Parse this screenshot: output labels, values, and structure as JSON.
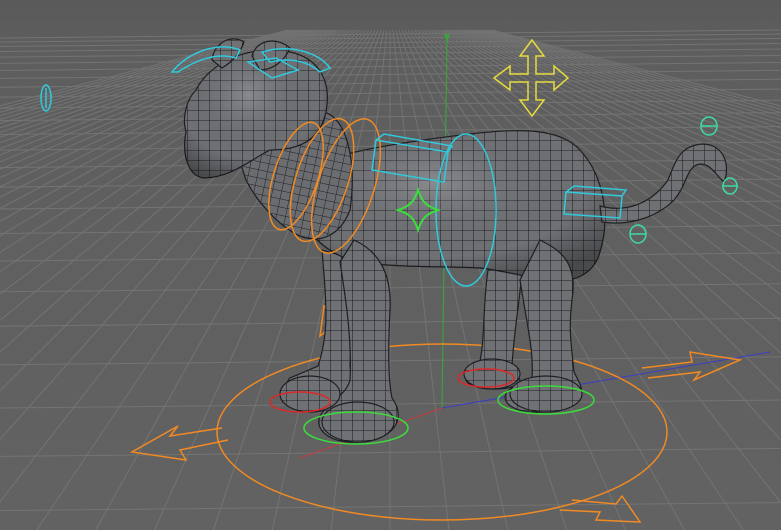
{
  "viewport": {
    "background_color": "#5e5e5e",
    "grid_color": "#767676",
    "mesh_fill_color": "#6e7074",
    "mesh_wire_color": "#1e1f22"
  },
  "subject": {
    "model": "cat-mesh",
    "display": "wireframe-shaded"
  },
  "axes": {
    "x_color": "#c83c3c",
    "y_color": "#3ca03c",
    "z_color": "#3c3cc8"
  },
  "rig_controls": {
    "cyan_color": "#32c8dc",
    "orange_color": "#f08a24",
    "yellow_color": "#e6dc3c",
    "green_color": "#3cdc3c",
    "teal_color": "#3cdca0",
    "red_color": "#dc2828",
    "items": [
      {
        "name": "ear-controls",
        "color": "cyan"
      },
      {
        "name": "neck-rings",
        "color": "orange"
      },
      {
        "name": "spine-shoulder-box",
        "color": "cyan"
      },
      {
        "name": "spine-ring",
        "color": "cyan"
      },
      {
        "name": "body-cog",
        "color": "green"
      },
      {
        "name": "hip-box",
        "color": "cyan"
      },
      {
        "name": "tail-controls",
        "color": "teal"
      },
      {
        "name": "move-cross",
        "color": "yellow"
      },
      {
        "name": "root-circle",
        "color": "orange"
      },
      {
        "name": "paw-controls",
        "color": "green"
      },
      {
        "name": "eye-target",
        "color": "cyan"
      }
    ]
  }
}
